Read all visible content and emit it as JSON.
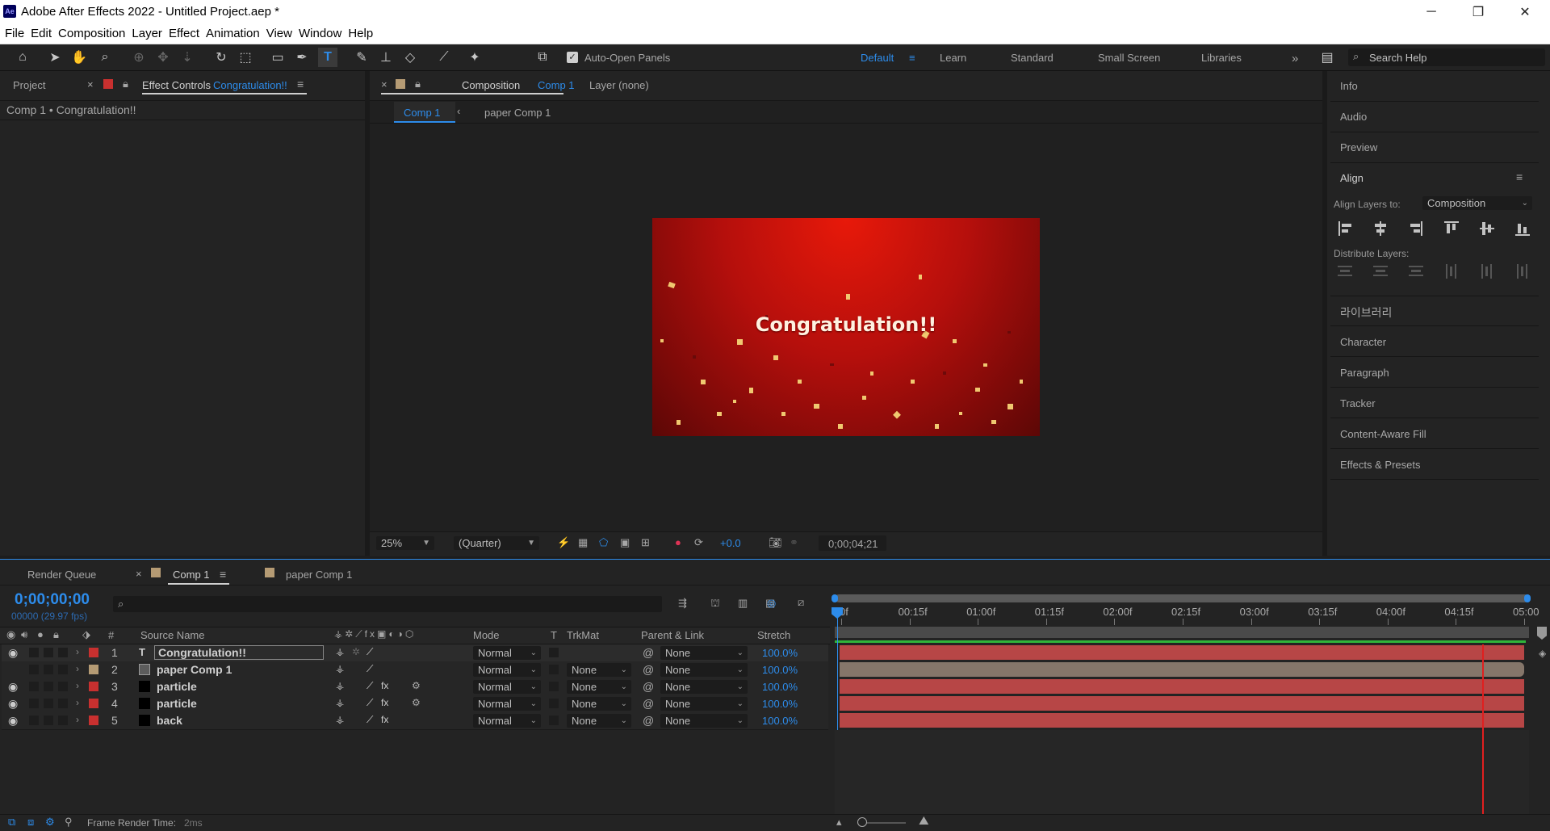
{
  "window": {
    "title": "Adobe After Effects 2022 - Untitled Project.aep *",
    "logo": "Ae",
    "min_icon": "─",
    "restore_icon": "❐",
    "close_icon": "✕"
  },
  "menu": [
    "File",
    "Edit",
    "Composition",
    "Layer",
    "Effect",
    "Animation",
    "View",
    "Window",
    "Help"
  ],
  "toolbar": {
    "auto_open": "Auto-Open Panels",
    "workspaces": [
      "Default",
      "Learn",
      "Standard",
      "Small Screen",
      "Libraries"
    ],
    "search_placeholder": "Search Help"
  },
  "left_panel": {
    "tab_project": "Project",
    "tab_effect_controls": "Effect Controls",
    "tab_effect_target": "Congratulation!!",
    "breadcrumb": "Comp 1 • Congratulation!!"
  },
  "comp_panel": {
    "tab_label": "Composition",
    "tab_comp": "Comp 1",
    "layer_tab": "Layer (none)",
    "subtabs": [
      "Comp 1",
      "paper Comp 1"
    ],
    "preview_text": "Congratulation!!",
    "zoom": "25%",
    "resolution": "(Quarter)",
    "exposure": "+0.0",
    "timecode": "0;00;04;21"
  },
  "right_panel": {
    "items_top": [
      "Info",
      "Audio",
      "Preview"
    ],
    "align_title": "Align",
    "align_to_label": "Align Layers to:",
    "align_to_value": "Composition",
    "distribute_label": "Distribute Layers:",
    "items_bottom": [
      "라이브러리",
      "Character",
      "Paragraph",
      "Tracker",
      "Content-Aware Fill",
      "Effects & Presets"
    ]
  },
  "timeline": {
    "tab_render": "Render Queue",
    "tab_comp": "Comp 1",
    "tab_paper": "paper Comp 1",
    "current_time": "0;00;00;00",
    "frame_info": "00000 (29.97 fps)",
    "headers": {
      "num": "#",
      "source": "Source Name",
      "mode": "Mode",
      "t": "T",
      "trkmat": "TrkMat",
      "parent": "Parent & Link",
      "stretch": "Stretch"
    },
    "ruler": [
      "0f",
      "00:15f",
      "01:00f",
      "01:15f",
      "02:00f",
      "02:15f",
      "03:00f",
      "03:15f",
      "04:00f",
      "04:15f",
      "05:00"
    ],
    "layers": [
      {
        "num": "1",
        "name": "Congratulation!!",
        "mode": "Normal",
        "trkmat": "",
        "parent": "None",
        "stretch": "100.0%",
        "label_color": "#c8302f",
        "bar_color": "#b74646",
        "type_icon": "T",
        "fx": false,
        "visible": true
      },
      {
        "num": "2",
        "name": "paper Comp 1",
        "mode": "Normal",
        "trkmat": "None",
        "parent": "None",
        "stretch": "100.0%",
        "label_color": "#b59b74",
        "bar_color": "#85766a",
        "type_icon": "comp",
        "fx": false,
        "visible": false
      },
      {
        "num": "3",
        "name": "particle",
        "mode": "Normal",
        "trkmat": "None",
        "parent": "None",
        "stretch": "100.0%",
        "label_color": "#c8302f",
        "bar_color": "#b74646",
        "type_icon": "solid",
        "fx": true,
        "visible": true
      },
      {
        "num": "4",
        "name": "particle",
        "mode": "Normal",
        "trkmat": "None",
        "parent": "None",
        "stretch": "100.0%",
        "label_color": "#c8302f",
        "bar_color": "#b74646",
        "type_icon": "solid",
        "fx": true,
        "visible": true
      },
      {
        "num": "5",
        "name": "back",
        "mode": "Normal",
        "trkmat": "None",
        "parent": "None",
        "stretch": "100.0%",
        "label_color": "#c8302f",
        "bar_color": "#b74646",
        "type_icon": "solid",
        "fx": true,
        "visible": true
      }
    ],
    "status": "Frame Render Time:",
    "render_time": "2ms"
  },
  "colors": {
    "accent": "#2d8ceb",
    "layer_red": "#c8302f",
    "playhead": "#e01f1f"
  }
}
